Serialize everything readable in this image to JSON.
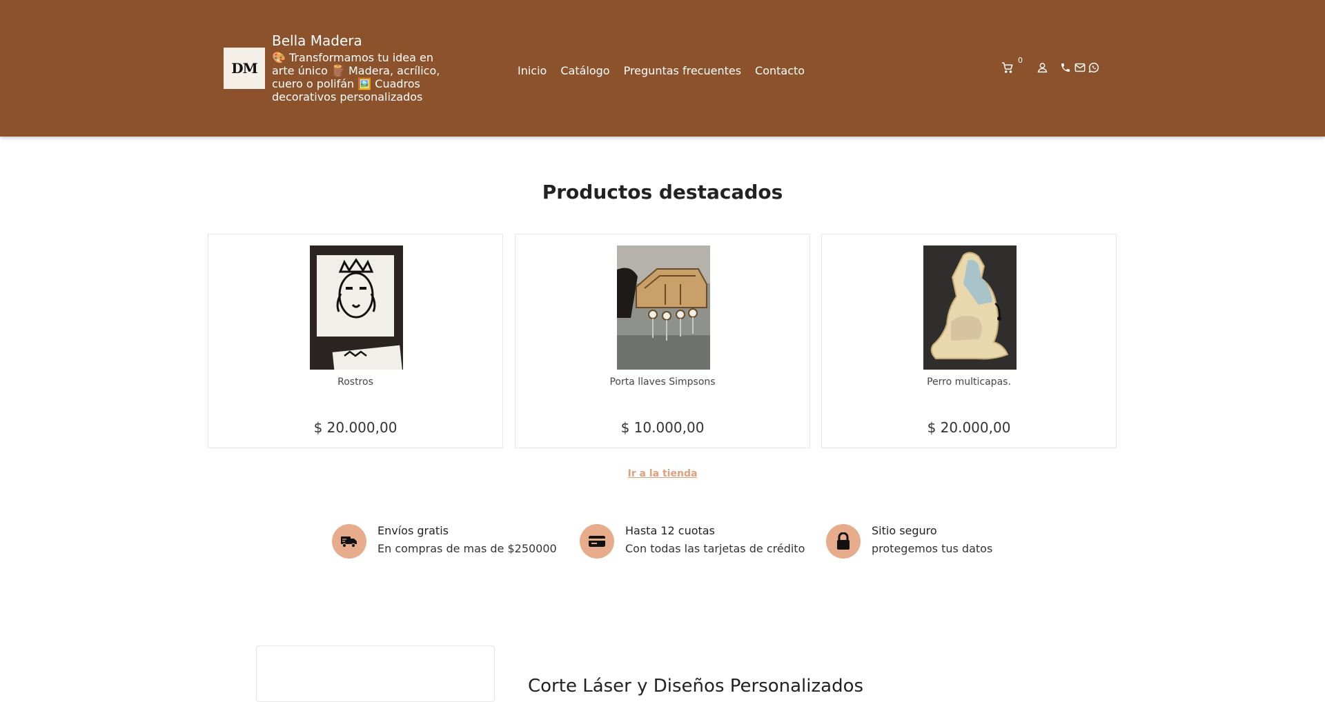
{
  "header": {
    "brand_name": "Bella Madera",
    "logo_text": "DM",
    "tagline": "🎨 Transformamos tu idea en arte único 🪵 Madera, acrílico, cuero o polifán 🖼️ Cuadros decorativos personalizados",
    "nav": [
      "Inicio",
      "Catálogo",
      "Preguntas frecuentes",
      "Contacto"
    ],
    "cart_count": "0",
    "icons": [
      "cart-icon",
      "user-icon",
      "phone-icon",
      "mail-icon",
      "whatsapp-icon"
    ],
    "background_color": "#8c522c"
  },
  "featured": {
    "title": "Productos destacados",
    "products": [
      {
        "name": "Rostros",
        "price": "$ 20.000,00"
      },
      {
        "name": "Porta llaves Simpsons",
        "price": "$ 10.000,00"
      },
      {
        "name": "Perro multicapas.",
        "price": "$ 20.000,00"
      }
    ],
    "shop_link": "Ir a la tienda"
  },
  "features": [
    {
      "title": "Envíos gratis",
      "subtitle": "En compras de mas de $250000",
      "icon": "truck-icon"
    },
    {
      "title": "Hasta 12 cuotas",
      "subtitle": "Con todas las tarjetas de crédito",
      "icon": "credit-card-icon"
    },
    {
      "title": "Sitio seguro",
      "subtitle": "protegemos tus datos",
      "icon": "lock-icon"
    }
  ],
  "accent_color": "#e7ac8b",
  "bottom": {
    "heading": "Corte Láser y Diseños Personalizados"
  }
}
